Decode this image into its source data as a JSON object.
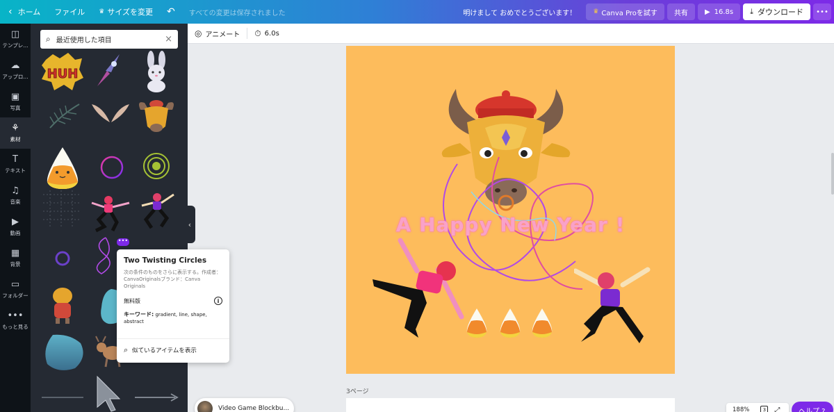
{
  "topbar": {
    "home": "ホーム",
    "file": "ファイル",
    "resize": "サイズを変更",
    "saved_status": "すべての変更は保存されました",
    "greeting": "明けまして おめでとうございます！",
    "pro_button": "Canva Proを試す",
    "share": "共有",
    "play_duration": "16.8s",
    "download": "ダウンロード"
  },
  "rail": {
    "items": [
      {
        "label": "テンプレ...",
        "icon": "template-icon"
      },
      {
        "label": "アップロ...",
        "icon": "upload-icon"
      },
      {
        "label": "写真",
        "icon": "photo-icon"
      },
      {
        "label": "素材",
        "icon": "elements-icon"
      },
      {
        "label": "テキスト",
        "icon": "text-icon"
      },
      {
        "label": "音楽",
        "icon": "music-icon"
      },
      {
        "label": "動画",
        "icon": "video-icon"
      },
      {
        "label": "背景",
        "icon": "background-icon"
      },
      {
        "label": "フォルダー",
        "icon": "folder-icon"
      },
      {
        "label": "もっと見る",
        "icon": "more-icon"
      }
    ]
  },
  "panel": {
    "search_value": "最近使用した項目"
  },
  "popover": {
    "title": "Two Twisting Circles",
    "description": "次の条件のものをさらに表示する。作成者：CanvaOriginalsブランド：Canva Originals",
    "license": "無料版",
    "keywords_label": "キーワード:",
    "keywords": "gradient, line, shape, abstract",
    "similar": "似ているアイテムを表示",
    "more_dots": "•••"
  },
  "editor_toolbar": {
    "animate": "アニメート",
    "duration": "6.0s"
  },
  "canvas": {
    "headline": "A Happy New Year !",
    "background_color": "#fdbc5c"
  },
  "page_label": "3ページ",
  "video_chip": "Video Game Blockbu...",
  "zoom": {
    "level": "188%",
    "pages": "3"
  },
  "help": "ヘルプ ?",
  "colors": {
    "accent": "#7d2ae8",
    "panel_bg": "#252a33",
    "rail_bg": "#0e1318"
  }
}
